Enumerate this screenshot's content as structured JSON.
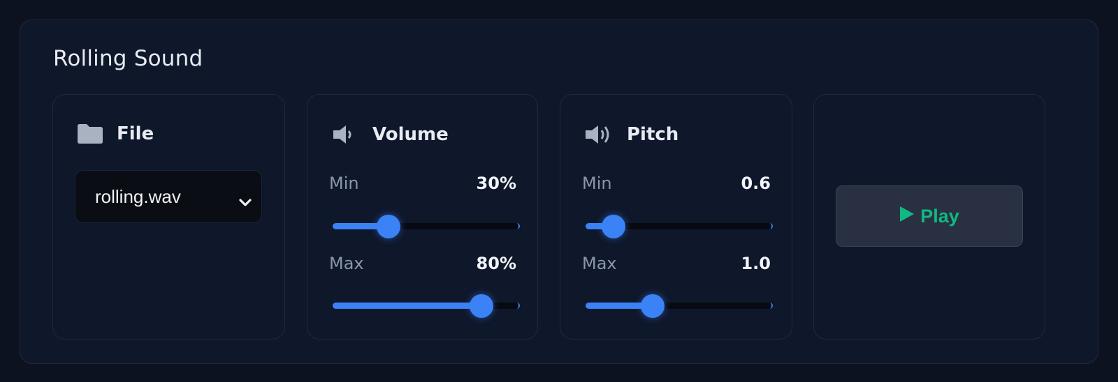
{
  "title": "Rolling Sound",
  "file_card": {
    "label": "File",
    "icon": "folder-icon",
    "selected": "rolling.wav"
  },
  "volume_card": {
    "label": "Volume",
    "icon": "speaker-low-icon",
    "min_label": "Min",
    "min_value": "30%",
    "min_fraction": 0.3,
    "max_label": "Max",
    "max_value": "80%",
    "max_fraction": 0.8
  },
  "pitch_card": {
    "label": "Pitch",
    "icon": "speaker-high-icon",
    "min_label": "Min",
    "min_value": "0.6",
    "min_fraction": 0.15,
    "max_label": "Max",
    "max_value": "1.0",
    "max_fraction": 0.36
  },
  "play_card": {
    "label": "Play",
    "icon": "play-icon"
  },
  "colors": {
    "accent": "#3b82f6",
    "play": "#10b981",
    "background": "#0f172b"
  }
}
